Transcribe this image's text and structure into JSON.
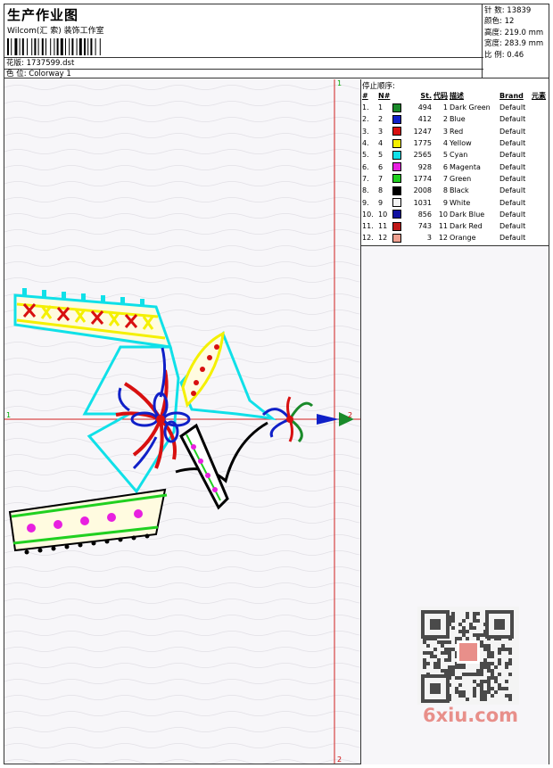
{
  "header": {
    "title": "生产作业图",
    "studio": "Wilcom(汇 索) 装饰工作室",
    "design_label": "花版:",
    "design_file": "1737599.dst",
    "colorway_label": "色 位:",
    "colorway": "Colorway 1"
  },
  "stats": {
    "stitches_label": "针 数:",
    "stitches": "13839",
    "colors_label": "颜色:",
    "colors": "12",
    "height_label": "高度:",
    "height": "219.0 mm",
    "width_label": "宽度:",
    "width": "283.9 mm",
    "scale_label": "比 例:",
    "scale": "0.46"
  },
  "stop_sequence": {
    "title": "停止顺序:",
    "headers": [
      "#",
      "N#",
      "St.",
      "代码",
      "描述",
      "Brand",
      "元素"
    ],
    "rows": [
      {
        "idx": "1.",
        "n": "1",
        "color": "#1a8a2a",
        "st": "494",
        "code": "1",
        "desc": "Dark Green",
        "brand": "Default"
      },
      {
        "idx": "2.",
        "n": "2",
        "color": "#1020c8",
        "st": "412",
        "code": "2",
        "desc": "Blue",
        "brand": "Default"
      },
      {
        "idx": "3.",
        "n": "3",
        "color": "#d81010",
        "st": "1247",
        "code": "3",
        "desc": "Red",
        "brand": "Default"
      },
      {
        "idx": "4.",
        "n": "4",
        "color": "#f4f000",
        "st": "1775",
        "code": "4",
        "desc": "Yellow",
        "brand": "Default"
      },
      {
        "idx": "5.",
        "n": "5",
        "color": "#10e0e8",
        "st": "2565",
        "code": "5",
        "desc": "Cyan",
        "brand": "Default"
      },
      {
        "idx": "6.",
        "n": "6",
        "color": "#e820e0",
        "st": "928",
        "code": "6",
        "desc": "Magenta",
        "brand": "Default"
      },
      {
        "idx": "7.",
        "n": "7",
        "color": "#20d020",
        "st": "1774",
        "code": "7",
        "desc": "Green",
        "brand": "Default"
      },
      {
        "idx": "8.",
        "n": "8",
        "color": "#000000",
        "st": "2008",
        "code": "8",
        "desc": "Black",
        "brand": "Default"
      },
      {
        "idx": "9.",
        "n": "9",
        "color": "#f4f4f4",
        "st": "1031",
        "code": "9",
        "desc": "White",
        "brand": "Default"
      },
      {
        "idx": "10.",
        "n": "10",
        "color": "#1010a0",
        "st": "856",
        "code": "10",
        "desc": "Dark Blue",
        "brand": "Default"
      },
      {
        "idx": "11.",
        "n": "11",
        "color": "#c01818",
        "st": "743",
        "code": "11",
        "desc": "Dark Red",
        "brand": "Default"
      },
      {
        "idx": "12.",
        "n": "12",
        "color": "#f0a090",
        "st": "3",
        "code": "12",
        "desc": "Orange",
        "brand": "Default"
      }
    ]
  },
  "axes": {
    "v_top": "1",
    "v_bottom": "2",
    "h_left": "1",
    "h_right": "2"
  },
  "watermark": {
    "text": "6xiu.com"
  }
}
